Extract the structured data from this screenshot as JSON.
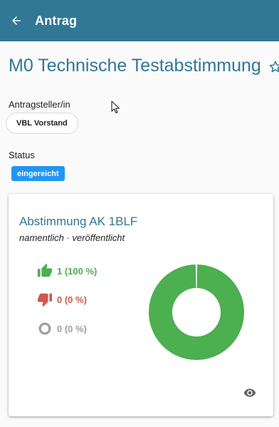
{
  "appbar": {
    "title": "Antrag",
    "back_icon": "arrow-left-icon"
  },
  "page": {
    "title": "M0 Technische Testabstimmung",
    "star_icon": "star-outline-icon"
  },
  "submitter": {
    "label": "Antragsteller/in",
    "chip": "VBL Vorstand"
  },
  "status": {
    "label": "Status",
    "badge": "eingereicht",
    "badge_color": "#2196f3"
  },
  "poll": {
    "title": "Abstimmung AK 1BLF",
    "subtitle": "namentlich · veröffentlicht",
    "results": [
      {
        "icon": "thumbs-up-icon",
        "text": "1 (100 %)",
        "color": "#4caf50",
        "value": 1,
        "percent": 100
      },
      {
        "icon": "thumbs-down-icon",
        "text": "0 (0 %)",
        "color": "#cc5a4e",
        "value": 0,
        "percent": 0
      },
      {
        "icon": "circle-outline-icon",
        "text": "0 (0 %)",
        "color": "#9e9e9e",
        "value": 0,
        "percent": 0
      }
    ],
    "visibility_icon": "eye-icon"
  },
  "chart_data": {
    "type": "pie",
    "categories": [
      "Ja",
      "Nein",
      "Enthaltung"
    ],
    "values": [
      1,
      0,
      0
    ],
    "colors": [
      "#4caf50",
      "#cc5a4e",
      "#9e9e9e"
    ],
    "donut": true
  },
  "colors": {
    "primary": "#317796",
    "background": "#fafafa"
  }
}
